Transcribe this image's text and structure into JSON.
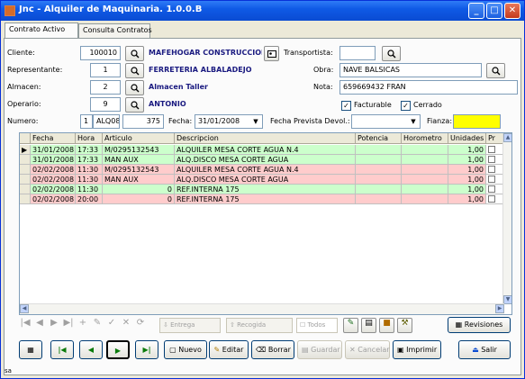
{
  "window": {
    "title": "Jnc - Alquiler de Maquinaria. 1.0.0.B"
  },
  "tabs": [
    "Contrato Activo",
    "Consulta Contratos"
  ],
  "form": {
    "cliente_label": "Cliente:",
    "cliente_code": "100010",
    "cliente_name": "MAFEHOGAR CONSTRUCCIONES",
    "transportista_label": "Transportista:",
    "transportista_value": "",
    "representante_label": "Representante:",
    "representante_code": "1",
    "representante_name": "FERRETERIA ALBALADEJO",
    "obra_label": "Obra:",
    "obra_value": "NAVE BALSICAS",
    "almacen_label": "Almacen:",
    "almacen_code": "2",
    "almacen_name": "Almacen Taller",
    "nota_label": "Nota:",
    "nota_value": "659669432 FRAN",
    "operario_label": "Operario:",
    "operario_code": "9",
    "operario_name": "ANTONIO",
    "facturable_label": "Facturable",
    "cerrado_label": "Cerrado",
    "facturable_checked": true,
    "cerrado_checked": true,
    "numero_label": "Numero:",
    "numero_serie": "1",
    "numero_prefix": "ALQ08",
    "numero_value": "375",
    "fecha_label": "Fecha:",
    "fecha_value": "31/01/2008",
    "fecha_prevista_label": "Fecha Prevista Devol.:",
    "fecha_prevista_value": "",
    "fianza_label": "Fianza:",
    "fianza_value": "",
    "fianza_color": "#ffff00"
  },
  "grid": {
    "columns": [
      "Fecha",
      "Hora",
      "Articulo",
      "Descripcion",
      "Potencia",
      "Horometro",
      "Unidades",
      "Pr"
    ],
    "rows": [
      {
        "fecha": "31/01/2008",
        "hora": "17:33",
        "articulo": "M/0295132543",
        "descripcion": "ALQUILER MESA CORTE AGUA N.4",
        "potencia": "",
        "horometro": "",
        "unidades": "1,00",
        "color": "#ccffcc",
        "current": true
      },
      {
        "fecha": "31/01/2008",
        "hora": "17:33",
        "articulo": "MAN AUX",
        "descripcion": "ALQ.DISCO MESA CORTE AGUA",
        "potencia": "",
        "horometro": "",
        "unidades": "1,00",
        "color": "#ccffcc",
        "current": false
      },
      {
        "fecha": "02/02/2008",
        "hora": "11:30",
        "articulo": "M/0295132543",
        "descripcion": "ALQUILER MESA CORTE AGUA N.4",
        "potencia": "",
        "horometro": "",
        "unidades": "1,00",
        "color": "#ffcccc",
        "current": false
      },
      {
        "fecha": "02/02/2008",
        "hora": "11:30",
        "articulo": "MAN AUX",
        "descripcion": "ALQ.DISCO MESA CORTE AGUA",
        "potencia": "",
        "horometro": "",
        "unidades": "1,00",
        "color": "#ffcccc",
        "current": false
      },
      {
        "fecha": "02/02/2008",
        "hora": "11:30",
        "articulo": "0",
        "descripcion": "REF.INTERNA 175",
        "potencia": "",
        "horometro": "",
        "unidades": "1,00",
        "color": "#ccffcc",
        "current": false
      },
      {
        "fecha": "02/02/2008",
        "hora": "20:00",
        "articulo": "0",
        "descripcion": "REF.INTERNA 175",
        "potencia": "",
        "horometro": "",
        "unidades": "1,00",
        "color": "#ffcccc",
        "current": false
      }
    ]
  },
  "navigator": {
    "entrega": "Entrega",
    "recogida": "Recogida",
    "todos": "Todos",
    "revisiones": "Revisiones"
  },
  "toolbar": {
    "nuevo": "Nuevo",
    "editar": "Editar",
    "borrar": "Borrar",
    "guardar": "Guardar",
    "cancelar": "Cancelar",
    "imprimir": "Imprimir",
    "salir": "Salir"
  },
  "statusbar": {
    "text": "sa"
  }
}
